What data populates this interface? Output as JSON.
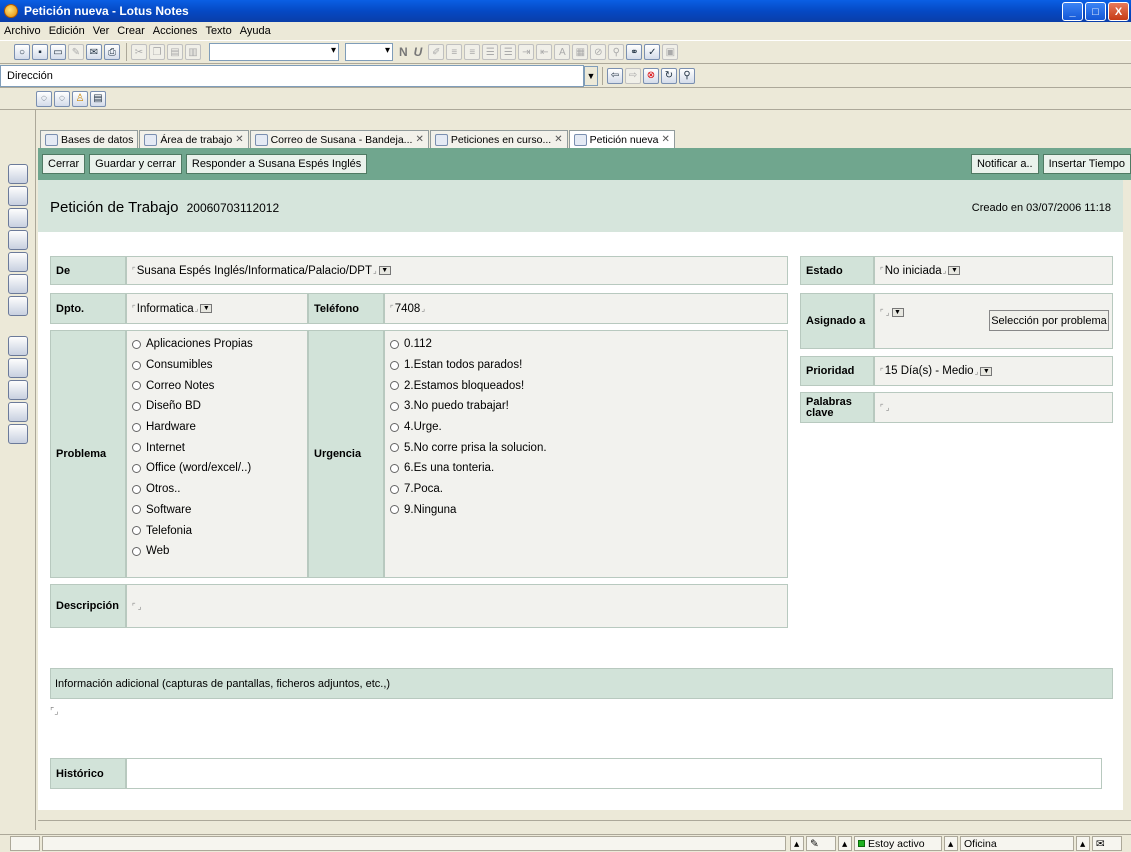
{
  "window": {
    "title": "Petición nueva - Lotus Notes",
    "min": "_",
    "max": "□",
    "close": "X"
  },
  "menu": [
    "Archivo",
    "Edición",
    "Ver",
    "Crear",
    "Acciones",
    "Texto",
    "Ayuda"
  ],
  "address": {
    "label": "Dirección"
  },
  "tabs": [
    {
      "label": "Bases de datos"
    },
    {
      "label": "Área de trabajo"
    },
    {
      "label": "Correo de Susana - Bandeja..."
    },
    {
      "label": "Peticiones en curso..."
    },
    {
      "label": "Petición nueva"
    }
  ],
  "actions": {
    "close": "Cerrar",
    "save_close": "Guardar y cerrar",
    "reply": "Responder a Susana Espés Inglés",
    "notify": "Notificar a..",
    "insert_time": "Insertar Tiempo"
  },
  "doc": {
    "title": "Petición de Trabajo",
    "number": "20060703112012",
    "created": "Creado en 03/07/2006 11:18"
  },
  "form": {
    "de_label": "De",
    "de_value": "Susana Espés Inglés/Informatica/Palacio/DPT",
    "dpto_label": "Dpto.",
    "dpto_value": "Informatica",
    "telefono_label": "Teléfono",
    "telefono_value": "7408",
    "problema_label": "Problema",
    "problema_options": [
      "Aplicaciones Propias",
      "Consumibles",
      "Correo Notes",
      "Diseño BD",
      "Hardware",
      "Internet",
      "Office (word/excel/..)",
      "Otros..",
      "Software",
      "Telefonia",
      "Web"
    ],
    "urgencia_label": "Urgencia",
    "urgencia_options": [
      "0.112",
      "1.Estan todos parados!",
      "2.Estamos bloqueados!",
      "3.No puedo trabajar!",
      "4.Urge.",
      "5.No corre prisa la solucion.",
      "6.Es una tonteria.",
      "7.Poca.",
      "9.Ninguna"
    ],
    "descripcion_label": "Descripción",
    "estado_label": "Estado",
    "estado_value": "No iniciada",
    "asignado_label": "Asignado a",
    "seleccion_button": "Selección por problema",
    "prioridad_label": "Prioridad",
    "prioridad_value": "15 Día(s) - Medio",
    "palabras_label_1": "Palabras",
    "palabras_label_2": "clave",
    "info_adicional": "Información adicional (capturas de pantallas, ficheros adjuntos, etc.,)",
    "historico_label": "Histórico"
  },
  "status": {
    "activo": "Estoy activo",
    "oficina": "Oficina"
  }
}
